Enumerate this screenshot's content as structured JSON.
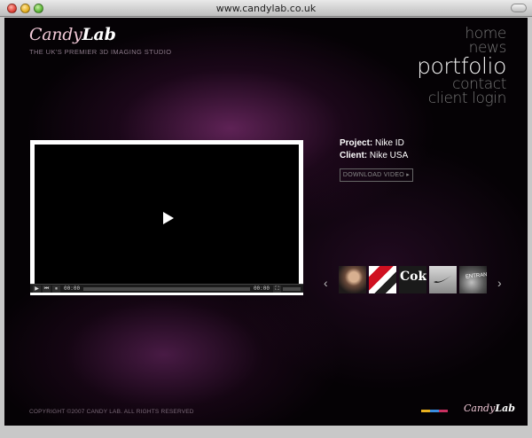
{
  "browser": {
    "url": "www.candylab.co.uk"
  },
  "logo": {
    "candy": "Candy",
    "lab": "Lab"
  },
  "tagline": "THE UK'S PREMIER 3D IMAGING STUDIO",
  "nav": {
    "home": "home",
    "news": "news",
    "portfolio": "portfolio",
    "contact": "contact",
    "client_login": "client login"
  },
  "project": {
    "project_label": "Project:",
    "project_value": "Nike ID",
    "client_label": "Client:",
    "client_value": "Nike USA",
    "download_label": "DOWNLOAD VIDEO ▸"
  },
  "player": {
    "current_time": "00:00",
    "duration": "00:00",
    "progress": 0
  },
  "thumbs": {
    "coke_text": "Coke",
    "sign_text": "ENTRANCE"
  },
  "colors": {
    "bar1": "#e8b020",
    "bar2": "#3a8ee0",
    "bar3": "#c83060"
  },
  "footer": {
    "copyright": "COPYRIGHT ©2007 CANDY LAB. ALL RIGHTS RESERVED",
    "logo_candy": "Candy",
    "logo_lab": "Lab"
  }
}
